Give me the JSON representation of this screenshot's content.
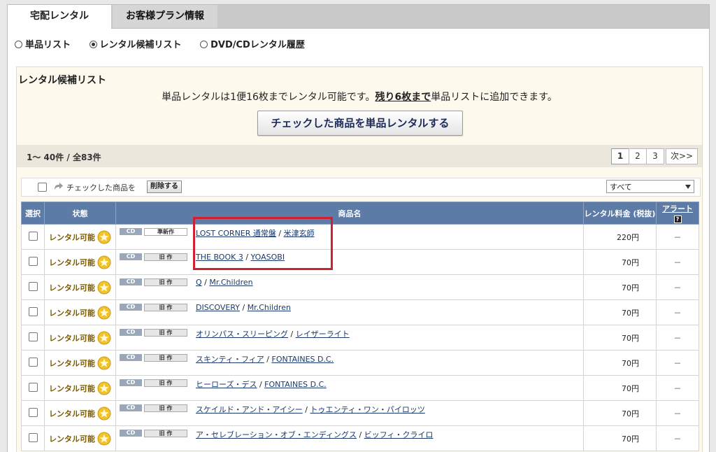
{
  "tabs": [
    {
      "label": "宅配レンタル",
      "active": true
    },
    {
      "label": "お客様プラン情報",
      "active": false
    }
  ],
  "radios": [
    {
      "label": "単品リスト",
      "checked": false
    },
    {
      "label": "レンタル候補リスト",
      "checked": true
    },
    {
      "label": "DVD/CDレンタル履歴",
      "checked": false
    }
  ],
  "panel": {
    "title": "レンタル候補リスト",
    "notice_pre": "単品レンタルは1便16枚までレンタル可能です。",
    "notice_strong": "残り6枚まで",
    "notice_post": "単品リストに追加できます。",
    "rent_button": "チェックした商品を単品レンタルする"
  },
  "pager": {
    "count": "1～ 40件 / 全83件",
    "pages": [
      "1",
      "2",
      "3"
    ],
    "next": "次>>",
    "current": "1"
  },
  "actionbar": {
    "label": "チェックした商品を",
    "delete": "削除する",
    "filter": "すべて"
  },
  "table": {
    "headers": {
      "select": "選択",
      "status": "状態",
      "name": "商品名",
      "price": "レンタル料金 (税抜)",
      "alert": "アラート"
    },
    "rows": [
      {
        "status": "レンタル可能",
        "media": "CD",
        "type": "準新作",
        "title": "LOST CORNER 通常盤",
        "artist": "米津玄師",
        "price": "220円",
        "alert": "－"
      },
      {
        "status": "レンタル可能",
        "media": "CD",
        "type": "旧 作",
        "title": "THE BOOK 3",
        "artist": "YOASOBI",
        "price": "70円",
        "alert": "－"
      },
      {
        "status": "レンタル可能",
        "media": "CD",
        "type": "旧 作",
        "title": "Q",
        "artist": "Mr.Children",
        "price": "70円",
        "alert": "－"
      },
      {
        "status": "レンタル可能",
        "media": "CD",
        "type": "旧 作",
        "title": "DISCOVERY",
        "artist": "Mr.Children",
        "price": "70円",
        "alert": "－"
      },
      {
        "status": "レンタル可能",
        "media": "CD",
        "type": "旧 作",
        "title": "オリンパス・スリーピング",
        "artist": "レイザーライト",
        "price": "70円",
        "alert": "－"
      },
      {
        "status": "レンタル可能",
        "media": "CD",
        "type": "旧 作",
        "title": "スキンティ・フィア",
        "artist": "FONTAINES D.C.",
        "price": "70円",
        "alert": "－"
      },
      {
        "status": "レンタル可能",
        "media": "CD",
        "type": "旧 作",
        "title": "ヒーローズ・デス",
        "artist": "FONTAINES D.C.",
        "price": "70円",
        "alert": "－"
      },
      {
        "status": "レンタル可能",
        "media": "CD",
        "type": "旧 作",
        "title": "スケイルド・アンド・アイシー",
        "artist": "トゥエンティ・ワン・パイロッツ",
        "price": "70円",
        "alert": "－"
      },
      {
        "status": "レンタル可能",
        "media": "CD",
        "type": "旧 作",
        "title": "ア・セレブレーション・オブ・エンディングス",
        "artist": "ビッフィ・クライロ",
        "price": "70円",
        "alert": "－"
      }
    ]
  },
  "colors": {
    "header_blue": "#5c7ba6",
    "panel_bg": "#fdf9ec",
    "highlight": "#cc2233",
    "link": "#1a3a6e"
  }
}
